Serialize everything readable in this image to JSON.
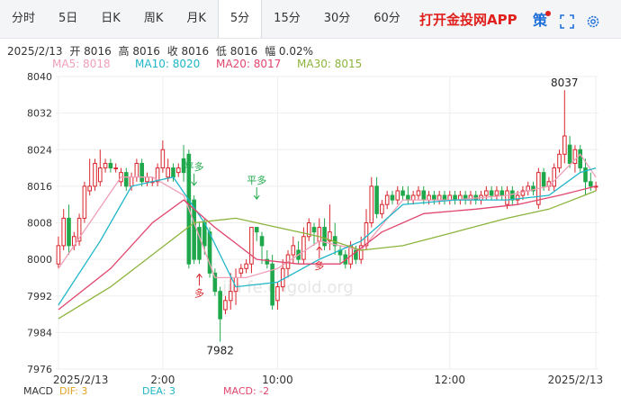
{
  "tabs": [
    {
      "label": "分时",
      "active": false
    },
    {
      "label": "5日",
      "active": false
    },
    {
      "label": "日K",
      "active": false
    },
    {
      "label": "周K",
      "active": false
    },
    {
      "label": "月K",
      "active": false
    },
    {
      "label": "5分",
      "active": true
    },
    {
      "label": "15分",
      "active": false
    },
    {
      "label": "30分",
      "active": false
    },
    {
      "label": "60分",
      "active": false
    }
  ],
  "promo": "打开金投网APP",
  "toolbar": {
    "strategy_label": "策",
    "expand_icon": "expand-icon",
    "settings_icon": "gear-icon"
  },
  "info": {
    "date": "2025/2/13",
    "open": "开 8016",
    "high": "高 8016",
    "close": "收 8016",
    "low": "低 8016",
    "amp": "幅 0.02%"
  },
  "ma": [
    {
      "label": "MA5: 8018",
      "color": "#f0a0b8"
    },
    {
      "label": "MA10: 8020",
      "color": "#1fb6c8"
    },
    {
      "label": "MA20: 8017",
      "color": "#e0466e"
    },
    {
      "label": "MA30: 8015",
      "color": "#8cb43c"
    }
  ],
  "watermark": "jin    fe.cngold.org",
  "bottom": {
    "macd": "MACD",
    "dif": "DIF: 3",
    "dea": "DEA: 3",
    "macd_val": "MACD: -2"
  },
  "colors": {
    "up": "#d8252c",
    "down": "#1fa84b",
    "grid": "#eeeeee",
    "axis_text": "#333333"
  },
  "chart_data": {
    "type": "candlestick",
    "ylim": [
      7976,
      8040
    ],
    "yticks": [
      7976,
      7984,
      7992,
      8000,
      8008,
      8016,
      8024,
      8032,
      8040
    ],
    "xticks": [
      {
        "label": "2025/2/13",
        "i": 0
      },
      {
        "label": "2:00",
        "i": 20
      },
      {
        "label": "10:00",
        "i": 42
      },
      {
        "label": "12:00",
        "i": 75
      },
      {
        "label": "2025/2/13",
        "i": 103
      }
    ],
    "candles": [
      [
        7999,
        8003,
        7998,
        8005
      ],
      [
        8003,
        8009,
        8002,
        8011
      ],
      [
        8009,
        8003,
        8001,
        8012
      ],
      [
        8003,
        8005,
        8002,
        8006
      ],
      [
        8004,
        8009,
        8003,
        8010
      ],
      [
        8009,
        8016,
        8008,
        8017
      ],
      [
        8015,
        8016,
        8014,
        8022
      ],
      [
        8016,
        8021,
        8015,
        8022
      ],
      [
        8017,
        8020,
        8016,
        8024
      ],
      [
        8020,
        8021,
        8019,
        8022
      ],
      [
        8021,
        8020,
        8019,
        8022
      ],
      [
        8020,
        8020,
        8019,
        8021
      ],
      [
        8017,
        8019,
        8016,
        8020
      ],
      [
        8019,
        8016,
        8015,
        8020
      ],
      [
        8016,
        8018,
        8015,
        8019
      ],
      [
        8018,
        8021,
        8017,
        8022
      ],
      [
        8021,
        8017,
        8016,
        8022
      ],
      [
        8017,
        8018,
        8016,
        8019
      ],
      [
        8017,
        8017,
        8016,
        8018
      ],
      [
        8017,
        8020,
        8016,
        8021
      ],
      [
        8020,
        8024,
        8019,
        8026
      ],
      [
        8018,
        8020,
        8017,
        8022
      ],
      [
        8020,
        8018,
        8017,
        8021
      ],
      [
        8019,
        8020,
        8018,
        8021
      ],
      [
        8022,
        8019,
        8017,
        8025
      ],
      [
        8023,
        7999,
        7998,
        8024
      ],
      [
        8013,
        8000,
        7999,
        8014
      ],
      [
        8007,
        8000,
        7999,
        8008
      ],
      [
        8008,
        8003,
        8001,
        8009
      ],
      [
        8006,
        7997,
        7996,
        8007
      ],
      [
        7997,
        7993,
        7992,
        7998
      ],
      [
        7993,
        7987,
        7982,
        7994
      ],
      [
        7989,
        7991,
        7988,
        7992
      ],
      [
        7991,
        7993,
        7989,
        7997
      ],
      [
        7993,
        7996,
        7990,
        7998
      ],
      [
        7997,
        7998,
        7996,
        7999
      ],
      [
        7998,
        7999,
        7997,
        8000
      ],
      [
        7999,
        8007,
        7997,
        8007
      ],
      [
        8007,
        8006,
        8004,
        8007
      ],
      [
        8005,
        8003,
        7999,
        8006
      ],
      [
        8000,
        7999,
        7998,
        8002
      ],
      [
        7999,
        7990,
        7989,
        8001
      ],
      [
        7991,
        7994,
        7989,
        7995
      ],
      [
        7994,
        7998,
        7993,
        8000
      ],
      [
        7998,
        8001,
        7996,
        8002
      ],
      [
        8001,
        8003,
        7999,
        8005
      ],
      [
        8002,
        8000,
        7999,
        8004
      ],
      [
        8000,
        8005,
        7999,
        8007
      ],
      [
        8005,
        8008,
        8004,
        8009
      ],
      [
        8007,
        8006,
        8003,
        8008
      ],
      [
        8004,
        8007,
        8003,
        8009
      ],
      [
        8007,
        8003,
        8002,
        8009
      ],
      [
        8004,
        8006,
        8002,
        8012
      ],
      [
        8005,
        8003,
        8001,
        8008
      ],
      [
        8002,
        8001,
        7999,
        8003
      ],
      [
        8001,
        7999,
        7998,
        8002
      ],
      [
        7999,
        8003,
        7998,
        8004
      ],
      [
        8002,
        8000,
        7999,
        8003
      ],
      [
        8000,
        8003,
        7999,
        8005
      ],
      [
        8003,
        8008,
        8002,
        8011
      ],
      [
        8008,
        8016,
        8007,
        8018
      ],
      [
        8016,
        8010,
        8009,
        8018
      ],
      [
        8010,
        8012,
        8009,
        8013
      ],
      [
        8012,
        8014,
        8011,
        8015
      ],
      [
        8014,
        8013,
        8012,
        8015
      ],
      [
        8013,
        8015,
        8012,
        8016
      ],
      [
        8015,
        8014,
        8013,
        8016
      ],
      [
        8014,
        8013,
        8012,
        8016
      ],
      [
        8013,
        8014,
        8012,
        8015
      ],
      [
        8014,
        8015,
        8013,
        8016
      ],
      [
        8015,
        8013,
        8012,
        8016
      ],
      [
        8013,
        8014,
        8012,
        8015
      ],
      [
        8014,
        8013,
        8012,
        8015
      ],
      [
        8013,
        8014,
        8012,
        8015
      ],
      [
        8014,
        8013,
        8012,
        8015
      ],
      [
        8013,
        8014,
        8012,
        8015
      ],
      [
        8014,
        8013,
        8012,
        8015
      ],
      [
        8013,
        8014,
        8012,
        8015
      ],
      [
        8014,
        8013,
        8012,
        8015
      ],
      [
        8013,
        8014,
        8012,
        8015
      ],
      [
        8014,
        8013,
        8012,
        8015
      ],
      [
        8013,
        8014,
        8012,
        8015
      ],
      [
        8014,
        8015,
        8013,
        8016
      ],
      [
        8015,
        8014,
        8013,
        8016
      ],
      [
        8014,
        8015,
        8013,
        8016
      ],
      [
        8015,
        8014,
        8013,
        8016
      ],
      [
        8012,
        8015,
        8011,
        8016
      ],
      [
        8015,
        8013,
        8012,
        8016
      ],
      [
        8013,
        8014,
        8012,
        8015
      ],
      [
        8014,
        8015,
        8013,
        8016
      ],
      [
        8015,
        8016,
        8014,
        8017
      ],
      [
        8016,
        8015,
        8014,
        8017
      ],
      [
        8012,
        8019,
        8011,
        8020
      ],
      [
        8019,
        8016,
        8015,
        8020
      ],
      [
        8016,
        8017,
        8015,
        8018
      ],
      [
        8016,
        8020,
        8015,
        8021
      ],
      [
        8020,
        8023,
        8019,
        8024
      ],
      [
        8023,
        8027,
        8021,
        8037
      ],
      [
        8025,
        8021,
        8020,
        8027
      ],
      [
        8021,
        8024,
        8019,
        8025
      ],
      [
        8024,
        8020,
        8019,
        8025
      ],
      [
        8020,
        8017,
        8014,
        8022
      ],
      [
        8017,
        8016,
        8015,
        8019
      ],
      [
        8016,
        8016,
        8015,
        8017
      ]
    ],
    "ma": [
      {
        "name": "MA5",
        "color": "#f0a0b8",
        "points": [
          [
            0,
            7998
          ],
          [
            6,
            8008
          ],
          [
            12,
            8018
          ],
          [
            18,
            8018
          ],
          [
            24,
            8014
          ],
          [
            30,
            7996
          ],
          [
            36,
            7996
          ],
          [
            42,
            7998
          ],
          [
            50,
            8004
          ],
          [
            58,
            8002
          ],
          [
            66,
            8013
          ],
          [
            76,
            8013
          ],
          [
            86,
            8014
          ],
          [
            94,
            8016
          ],
          [
            100,
            8023
          ],
          [
            103,
            8018
          ]
        ]
      },
      {
        "name": "MA10",
        "color": "#1fb6c8",
        "points": [
          [
            0,
            7990
          ],
          [
            8,
            8004
          ],
          [
            14,
            8016
          ],
          [
            22,
            8018
          ],
          [
            28,
            8008
          ],
          [
            34,
            7994
          ],
          [
            42,
            7995
          ],
          [
            50,
            8000
          ],
          [
            58,
            8004
          ],
          [
            66,
            8012
          ],
          [
            76,
            8013
          ],
          [
            86,
            8013
          ],
          [
            94,
            8014
          ],
          [
            100,
            8019
          ],
          [
            103,
            8020
          ]
        ]
      },
      {
        "name": "MA20",
        "color": "#e0466e",
        "points": [
          [
            0,
            7989
          ],
          [
            10,
            7998
          ],
          [
            18,
            8008
          ],
          [
            24,
            8013
          ],
          [
            30,
            8007
          ],
          [
            38,
            8000
          ],
          [
            46,
            7999
          ],
          [
            54,
            7999
          ],
          [
            62,
            8006
          ],
          [
            70,
            8010
          ],
          [
            80,
            8011
          ],
          [
            88,
            8012
          ],
          [
            96,
            8014
          ],
          [
            103,
            8016
          ]
        ]
      },
      {
        "name": "MA30",
        "color": "#8cb43c",
        "points": [
          [
            0,
            7987
          ],
          [
            10,
            7994
          ],
          [
            18,
            8001
          ],
          [
            26,
            8008
          ],
          [
            34,
            8009
          ],
          [
            42,
            8007
          ],
          [
            50,
            8005
          ],
          [
            58,
            8002
          ],
          [
            66,
            8003
          ],
          [
            76,
            8006
          ],
          [
            86,
            8009
          ],
          [
            94,
            8011
          ],
          [
            103,
            8015
          ]
        ]
      }
    ],
    "labels": [
      {
        "text": "8037",
        "i": 97,
        "v": 8037,
        "pos": "above"
      },
      {
        "text": "7982",
        "i": 31,
        "v": 7982,
        "pos": "below"
      }
    ],
    "signals": [
      {
        "text": "平多",
        "i": 26,
        "v": 8016,
        "dir": "down",
        "color": "#1fa84b"
      },
      {
        "text": "平多",
        "i": 38,
        "v": 8013,
        "dir": "down",
        "color": "#1fa84b"
      },
      {
        "text": "多",
        "i": 27,
        "v": 7997,
        "dir": "up",
        "color": "#d8252c"
      },
      {
        "text": "多",
        "i": 50,
        "v": 8003,
        "dir": "up",
        "color": "#d8252c"
      }
    ]
  }
}
